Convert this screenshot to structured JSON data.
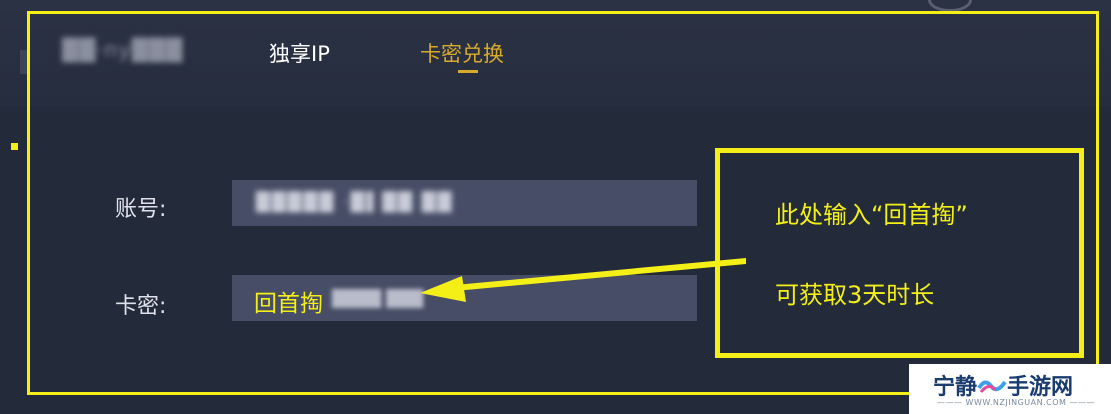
{
  "tabs": {
    "account_tab_blurred": "██·ny███",
    "exclusive_ip": "独享IP",
    "card_redeem": "卡密兑换"
  },
  "form": {
    "account_label": "账号:",
    "account_value_blurred": "█████ ·█▌██ ██",
    "card_label": "卡密:",
    "card_typed_value": "回首掏",
    "card_blurred_suffix": "████ ███"
  },
  "annotation": {
    "line1": "此处输入“回首掏”",
    "line2": "可获取3天时长"
  },
  "watermark": {
    "name_left": "宁静",
    "name_right": "手游网",
    "url": "——— WWW.NZJINGUAN.COM ———"
  },
  "colors": {
    "highlight": "#f3ef17",
    "accent_tab": "#d8aa2c",
    "panel_bg": "#232a3a",
    "input_bg": "#474d66"
  }
}
